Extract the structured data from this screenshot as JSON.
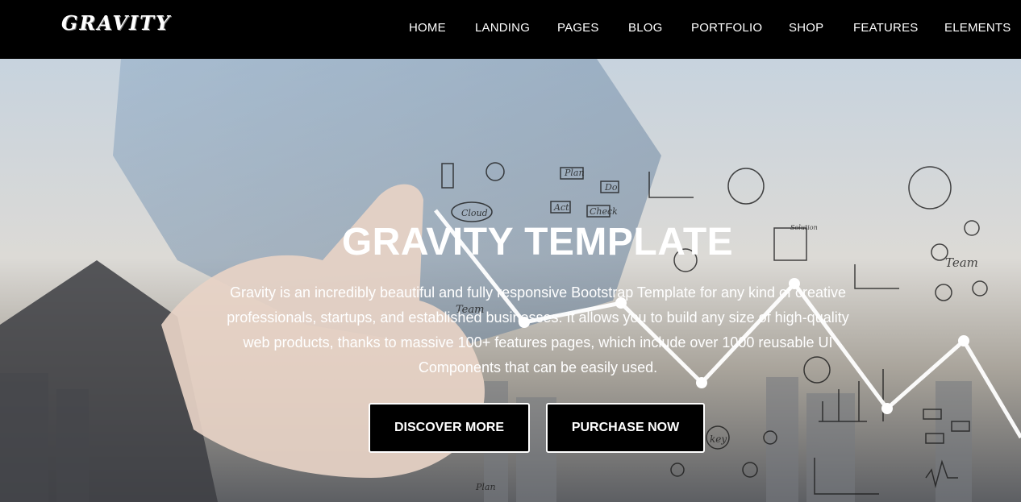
{
  "nav": {
    "logo": "GRAVITY",
    "items": [
      {
        "label": "HOME"
      },
      {
        "label": "LANDING"
      },
      {
        "label": "PAGES"
      },
      {
        "label": "BLOG"
      },
      {
        "label": "PORTFOLIO"
      },
      {
        "label": "SHOP"
      },
      {
        "label": "FEATURES"
      },
      {
        "label": "ELEMENTS"
      }
    ]
  },
  "hero": {
    "title": "GRAVITY TEMPLATE",
    "description": "Gravity is an incredibly beautiful and fully responsive Bootstrap Template for any kind of creative professionals, startups, and established businesses. It allows you to build any size of high-quality web products, thanks to massive 100+ features pages, which include over 1000 reusable UI Components that can be easily used.",
    "buttons": {
      "discover": "DISCOVER MORE",
      "purchase": "PURCHASE NOW"
    },
    "sketch_labels": [
      "Cloud",
      "Plan",
      "Do",
      "Act",
      "Check",
      "Team",
      "Team",
      "key",
      "Solution",
      "Plan"
    ]
  }
}
